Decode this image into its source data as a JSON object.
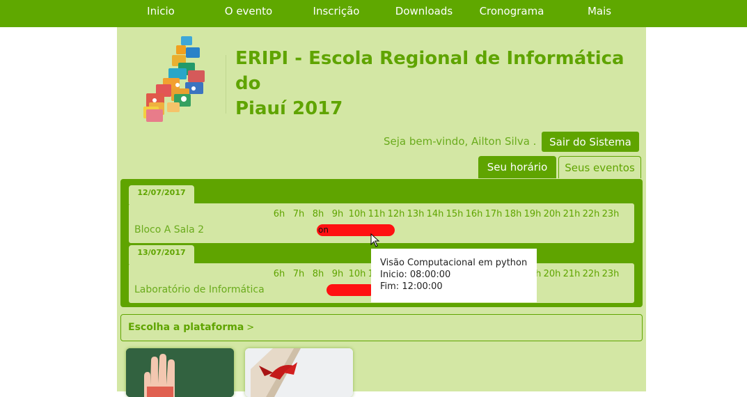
{
  "nav": {
    "items": [
      "Inicio",
      "O evento",
      "Inscrição",
      "Downloads",
      "Cronograma",
      "Mais"
    ]
  },
  "header": {
    "title_line1": "ERIPI - Escola Regional de Informática do",
    "title_line2": "Piauí 2017"
  },
  "user": {
    "welcome": "Seja bem-vindo, Ailton Silva .",
    "logout_label": "Sair do Sistema"
  },
  "tabs": {
    "active": "Seu horário",
    "inactive": "Seus eventos"
  },
  "schedule": {
    "hours": [
      "6h",
      "7h",
      "8h",
      "9h",
      "10h",
      "11h",
      "12h",
      "13h",
      "14h",
      "15h",
      "16h",
      "17h",
      "18h",
      "19h",
      "20h",
      "21h",
      "22h",
      "23h"
    ],
    "days": [
      {
        "date": "12/07/2017",
        "room": "Bloco A Sala 2",
        "event_start_hour": 8,
        "event_end_hour": 12,
        "bar_label": "on"
      },
      {
        "date": "13/07/2017",
        "room": "Laboratório de Informática",
        "event_start_hour": 8.5,
        "event_end_hour": 11,
        "bar_label": ""
      }
    ]
  },
  "tooltip": {
    "title": "Visão Computacional em python",
    "start": "Inicio: 08:00:00",
    "end": "Fim: 12:00:00"
  },
  "platform": {
    "label": "Escolha a plataforma",
    "arrow": ">"
  },
  "colors": {
    "nav_bg": "#5fa800",
    "panel_bg": "#d3e7a4",
    "accent": "#5fa400",
    "event_bar": "#ff1111"
  }
}
